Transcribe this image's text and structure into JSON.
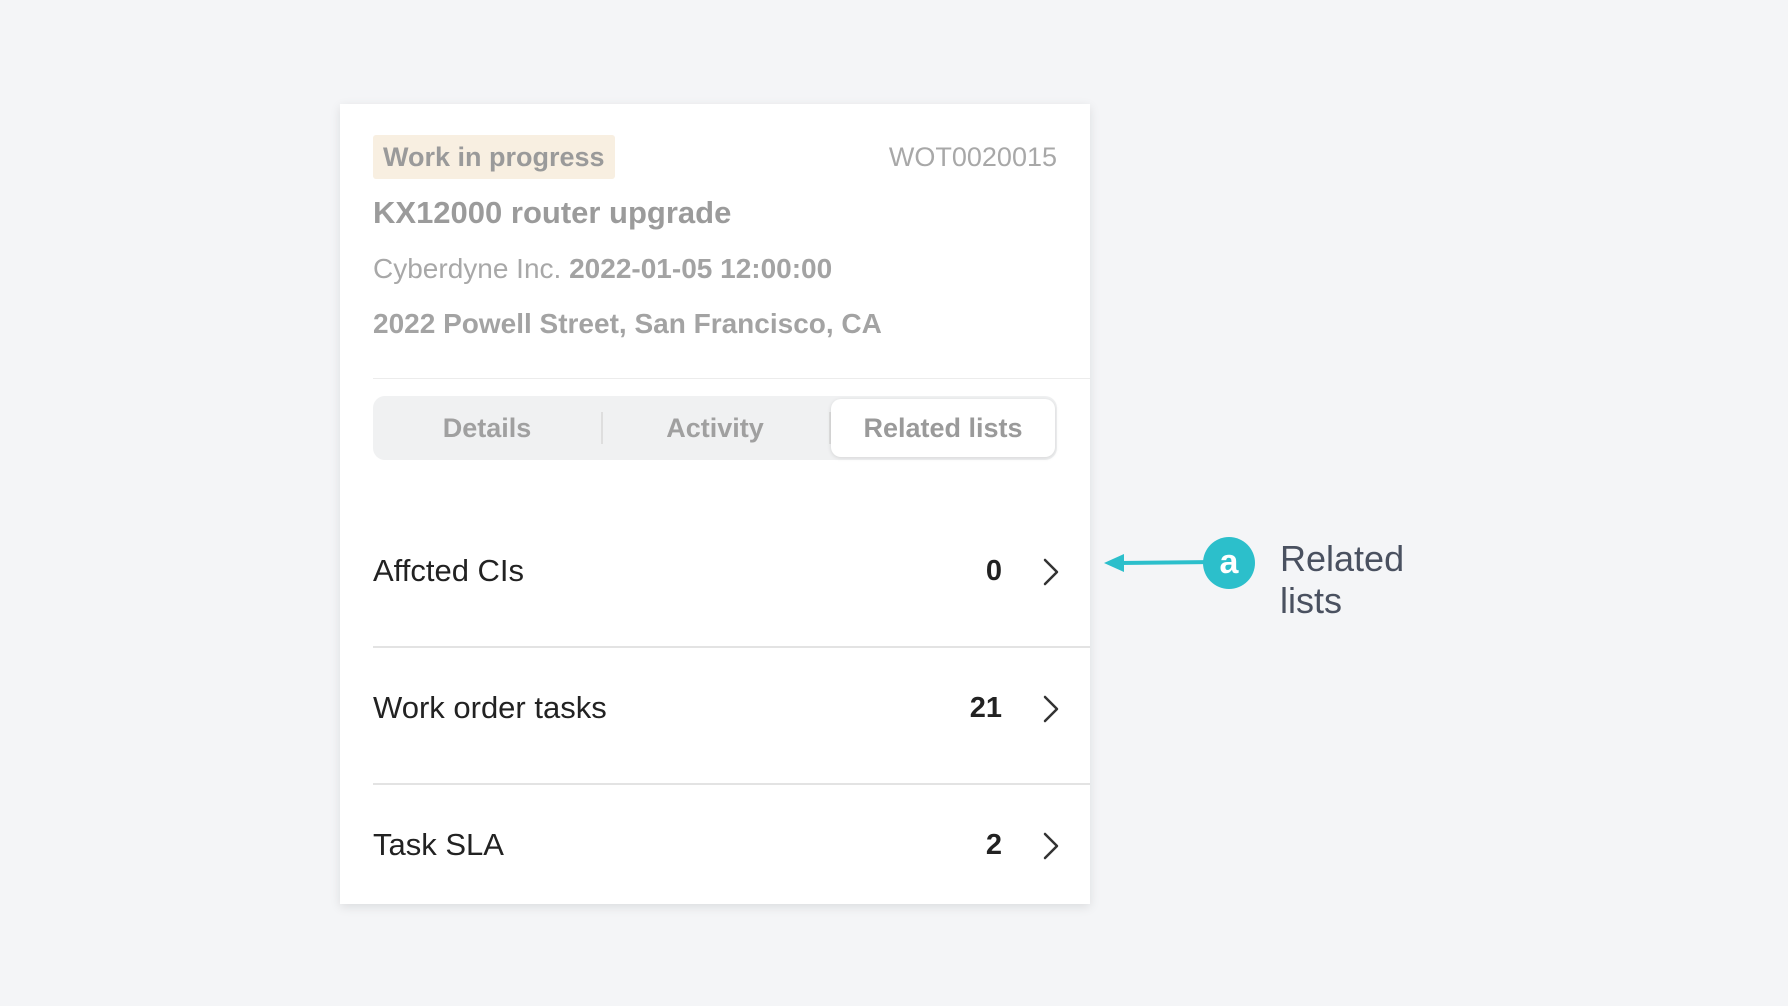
{
  "work_order": {
    "status": "Work in progress",
    "number": "WOT0020015",
    "title": "KX12000 router upgrade",
    "company": "Cyberdyne Inc.",
    "datetime": "2022-01-05 12:00:00",
    "address": "2022 Powell Street, San Francisco, CA",
    "status_badge_color": "#f8efe1"
  },
  "tabs": [
    {
      "label": "Details",
      "selected": false
    },
    {
      "label": "Activity",
      "selected": false
    },
    {
      "label": "Related lists",
      "selected": true
    }
  ],
  "related_lists": [
    {
      "label": "Affcted CIs",
      "count": "0",
      "icon": "chevron-right-icon"
    },
    {
      "label": "Work order tasks",
      "count": "21",
      "icon": "chevron-right-icon"
    },
    {
      "label": "Task SLA",
      "count": "2",
      "icon": "chevron-right-icon"
    }
  ],
  "callout": {
    "marker": "a",
    "label_line1": "Related",
    "label_line2": "lists",
    "color": "#2cbfcb",
    "icon": "arrow-left-icon"
  }
}
